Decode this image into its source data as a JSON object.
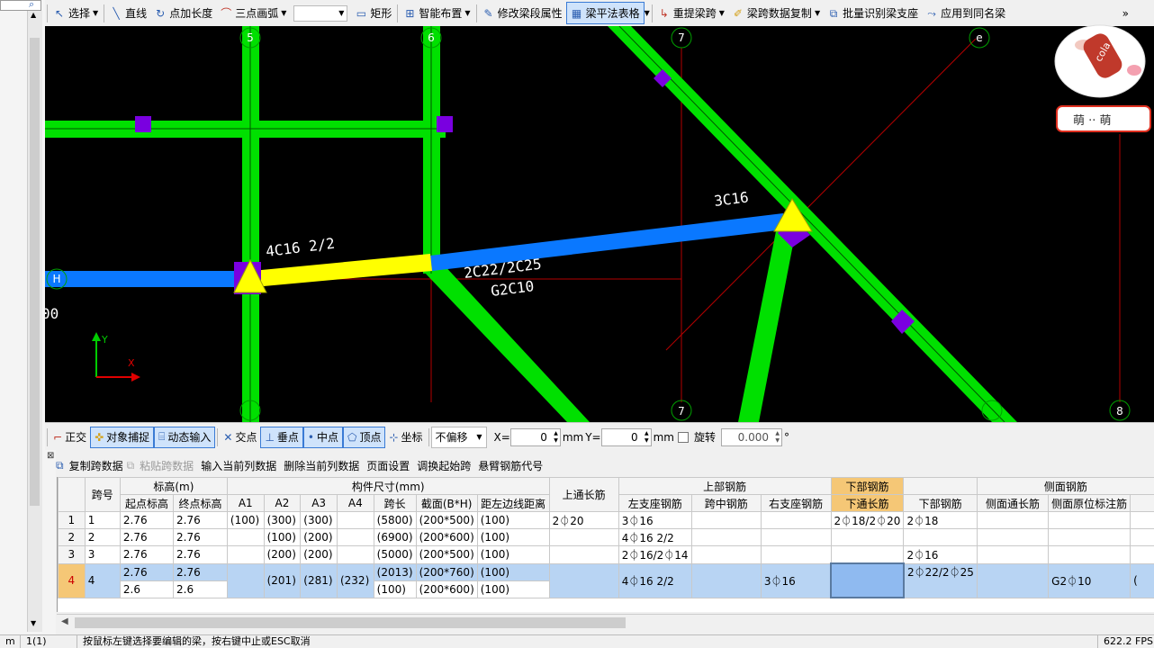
{
  "toolbar": {
    "items": [
      {
        "label": "选择",
        "icon": "pointer-icon",
        "dropdown": true
      },
      {
        "label": "直线",
        "icon": "line-icon"
      },
      {
        "label": "点加长度",
        "icon": "point-length-icon"
      },
      {
        "label": "三点画弧",
        "icon": "arc-icon",
        "dropdown": true
      },
      {
        "label": "矩形",
        "icon": "rectangle-icon"
      },
      {
        "label": "智能布置",
        "icon": "smart-layout-icon",
        "dropdown": true
      },
      {
        "label": "修改梁段属性",
        "icon": "edit-beam-icon"
      },
      {
        "label": "梁平法表格",
        "icon": "beam-table-icon",
        "active": true,
        "dropdown": true
      },
      {
        "label": "重提梁跨",
        "icon": "reextract-span-icon",
        "dropdown": true
      },
      {
        "label": "梁跨数据复制",
        "icon": "copy-span-icon",
        "dropdown": true
      },
      {
        "label": "批量识别梁支座",
        "icon": "batch-identify-icon"
      },
      {
        "label": "应用到同名梁",
        "icon": "apply-same-icon"
      }
    ],
    "overflow": "»"
  },
  "canvas": {
    "axis_labels": [
      "5",
      "6",
      "7",
      "e",
      "H",
      "7",
      "8"
    ],
    "annotations": [
      "3C16",
      "4C16 2/2",
      "2C22/2C25",
      "G2C10",
      "00"
    ],
    "ucs": {
      "x": "X",
      "y": "Y"
    }
  },
  "mascot": {
    "bottle_text": "cola",
    "banner_text": "萌 ·· 萌"
  },
  "snapbar": {
    "items": [
      {
        "label": "正交",
        "on": false
      },
      {
        "label": "对象捕捉",
        "on": true
      },
      {
        "label": "动态输入",
        "on": true
      },
      {
        "label": "交点",
        "on": false
      },
      {
        "label": "垂点",
        "on": true
      },
      {
        "label": "中点",
        "on": true
      },
      {
        "label": "顶点",
        "on": true
      },
      {
        "label": "坐标",
        "on": false
      }
    ],
    "offset_mode": "不偏移",
    "x_label": "X=",
    "x_value": "0",
    "x_unit": "mm",
    "y_label": "Y=",
    "y_value": "0",
    "y_unit": "mm",
    "rotate_label": "旋转",
    "rotate_value": "0.000",
    "degree": "°"
  },
  "table_toolbar": {
    "items": [
      {
        "label": "复制跨数据",
        "enabled": true
      },
      {
        "label": "粘贴跨数据",
        "enabled": false
      },
      {
        "label": "输入当前列数据",
        "enabled": true
      },
      {
        "label": "删除当前列数据",
        "enabled": true
      },
      {
        "label": "页面设置",
        "enabled": true
      },
      {
        "label": "调换起始跨",
        "enabled": true
      },
      {
        "label": "悬臂钢筋代号",
        "enabled": true
      }
    ]
  },
  "grid": {
    "group_headers": {
      "span": "跨号",
      "elevation": "标高(m)",
      "size": "构件尺寸(mm)",
      "top_through": "上通长筋",
      "top_rebar": "上部钢筋",
      "bottom_rebar": "下部钢筋",
      "side_rebar": "侧面钢筋"
    },
    "columns": {
      "start_elev": "起点标高",
      "end_elev": "终点标高",
      "a1": "A1",
      "a2": "A2",
      "a3": "A3",
      "a4": "A4",
      "span_len": "跨长",
      "section": "截面(B*H)",
      "left_dist": "距左边线距离",
      "left_support": "左支座钢筋",
      "mid": "跨中钢筋",
      "right_support": "右支座钢筋",
      "bottom_through": "下通长筋",
      "bottom": "下部钢筋",
      "side_through": "侧面通长筋",
      "side_in_situ": "侧面原位标注筋"
    },
    "rows": [
      {
        "n": "1",
        "span": "1",
        "start": "2.76",
        "end": "2.76",
        "a1": "(100)",
        "a2": "(300)",
        "a3": "(300)",
        "a4": "",
        "len": "(5800)",
        "sec": "(200*500)",
        "dist": "(100)",
        "top_through": "2⏀20",
        "left": "3⏀16",
        "mid": "",
        "right": "",
        "b_through": "2⏀18/2⏀20",
        "bottom": "2⏀18",
        "side_through": "",
        "side": ""
      },
      {
        "n": "2",
        "span": "2",
        "start": "2.76",
        "end": "2.76",
        "a1": "",
        "a2": "(100)",
        "a3": "(200)",
        "a4": "",
        "len": "(6900)",
        "sec": "(200*600)",
        "dist": "(100)",
        "top_through": "",
        "left": "4⏀16 2/2",
        "mid": "",
        "right": "",
        "b_through": "",
        "bottom": "",
        "side_through": "",
        "side": ""
      },
      {
        "n": "3",
        "span": "3",
        "start": "2.76",
        "end": "2.76",
        "a1": "",
        "a2": "(200)",
        "a3": "(200)",
        "a4": "",
        "len": "(5000)",
        "sec": "(200*500)",
        "dist": "(100)",
        "top_through": "",
        "left": "2⏀16/2⏀14",
        "mid": "",
        "right": "",
        "b_through": "",
        "bottom": "2⏀16",
        "side_through": "",
        "side": ""
      }
    ],
    "row4": {
      "n": "4",
      "span": "4",
      "start_a": "2.76",
      "end_a": "2.76",
      "start_b": "2.6",
      "end_b": "2.6",
      "a1": "",
      "a2": "(201)",
      "a3": "(281)",
      "a4": "(232)",
      "len_a": "(2013)",
      "sec_a": "(200*760)",
      "dist_a": "(100)",
      "len_b": "(100)",
      "sec_b": "(200*600)",
      "dist_b": "(100)",
      "left": "4⏀16 2/2",
      "mid": "",
      "right": "3⏀16",
      "b_through": "",
      "bottom": "2⏀22/2⏀25",
      "side_through": "",
      "side": "G2⏀10",
      "extra": "("
    }
  },
  "status": {
    "left": "m",
    "coord": "1(1)",
    "message": "按鼠标左键选择要编辑的梁，按右键中止或ESC取消",
    "fps": "622.2 FPS"
  }
}
